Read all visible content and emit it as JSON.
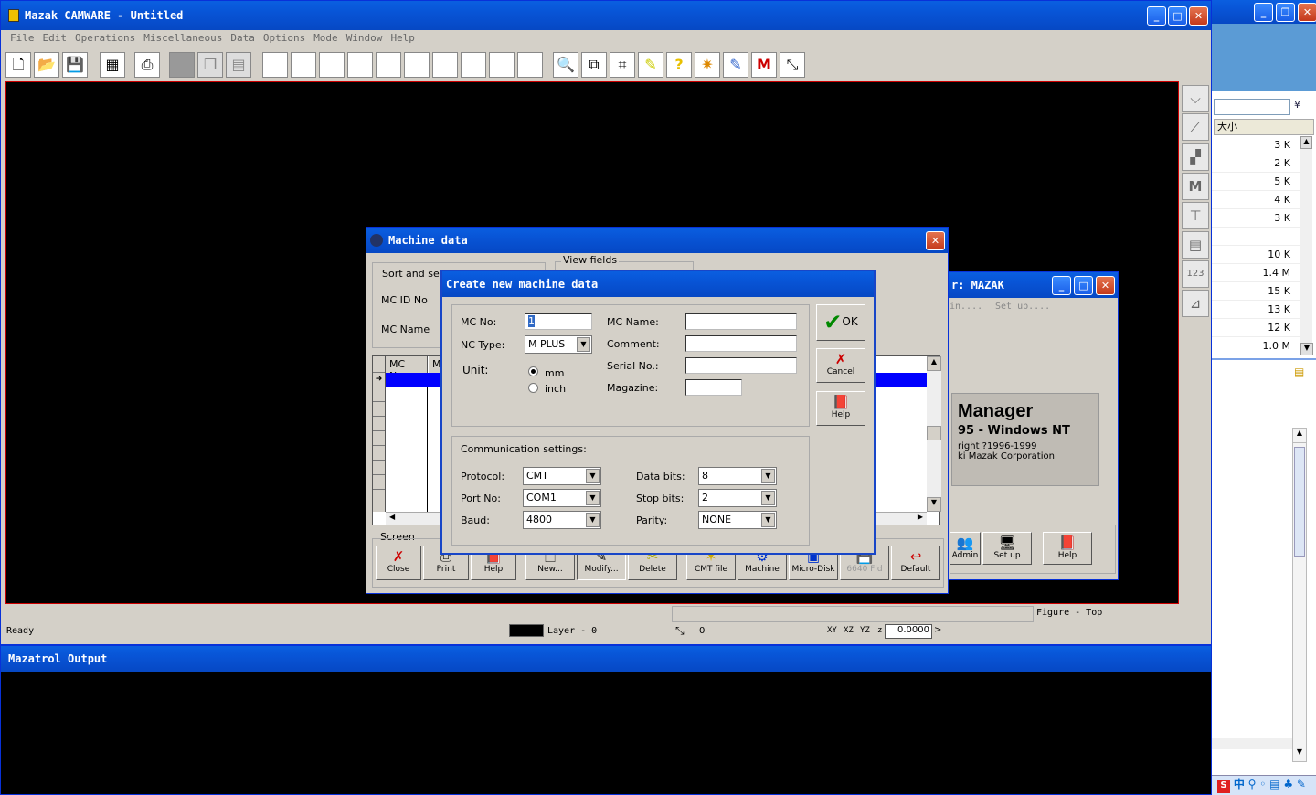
{
  "main_window": {
    "title": "Mazak CAMWARE - Untitled",
    "menu": [
      "File",
      "Edit",
      "Operations",
      "Miscellaneous",
      "Data",
      "Options",
      "Mode",
      "Window",
      "Help"
    ]
  },
  "status_bar": {
    "ready": "Ready",
    "layer": "Layer - 0",
    "coord": "0",
    "xy": "XY",
    "xz": "XZ",
    "yz": "YZ",
    "z": "z",
    "z_value": "0.0000",
    "figure": "Figure - Top"
  },
  "output_window": {
    "title": "Mazatrol Output"
  },
  "machine_dialog": {
    "title": "Machine data",
    "sort_group": "Sort and sear",
    "view_fields": "View fields",
    "mc_id_label": "MC ID No",
    "mc_name_label": "MC Name",
    "col_mc_no": "MC No.",
    "col_m": "M",
    "screen_label": "Screen",
    "buttons": [
      "Close",
      "Print",
      "Help",
      "New...",
      "Modify...",
      "Delete",
      "CMT file",
      "Machine",
      "Micro-Disk",
      "6640 Fld",
      "Default"
    ]
  },
  "bg_manager": {
    "title": "r: MAZAK",
    "menu": [
      "in....",
      "Set up...."
    ],
    "heading": "Manager",
    "line1": "95 - Windows NT",
    "line2": "right ?1996-1999",
    "line3": "ki Mazak Corporation",
    "buttons": [
      "Admin",
      "Set up",
      "Help"
    ]
  },
  "create_dialog": {
    "title": "Create new machine data",
    "mc_no_label": "MC No:",
    "mc_no_value": "1",
    "nc_type_label": "NC Type:",
    "nc_type_value": "M PLUS",
    "unit_label": "Unit:",
    "unit_mm": "mm",
    "unit_inch": "inch",
    "mc_name_label": "MC Name:",
    "comment_label": "Comment:",
    "serial_label": "Serial No.:",
    "magazine_label": "Magazine:",
    "comm_title": "Communication settings:",
    "protocol_label": "Protocol:",
    "protocol_value": "CMT",
    "port_label": "Port No:",
    "port_value": "COM1",
    "baud_label": "Baud:",
    "baud_value": "4800",
    "databits_label": "Data bits:",
    "databits_value": "8",
    "stopbits_label": "Stop bits:",
    "stopbits_value": "2",
    "parity_label": "Parity:",
    "parity_value": "NONE",
    "ok": "OK",
    "cancel": "Cancel",
    "help": "Help"
  },
  "right_panel": {
    "header": "大小",
    "sizes": [
      "3 K",
      "2 K",
      "5 K",
      "4 K",
      "3 K",
      "",
      "10 K",
      "1.4 M",
      "15 K",
      "13 K",
      "12 K",
      "1.0 M"
    ]
  },
  "taskbar": {
    "ime": "中"
  }
}
